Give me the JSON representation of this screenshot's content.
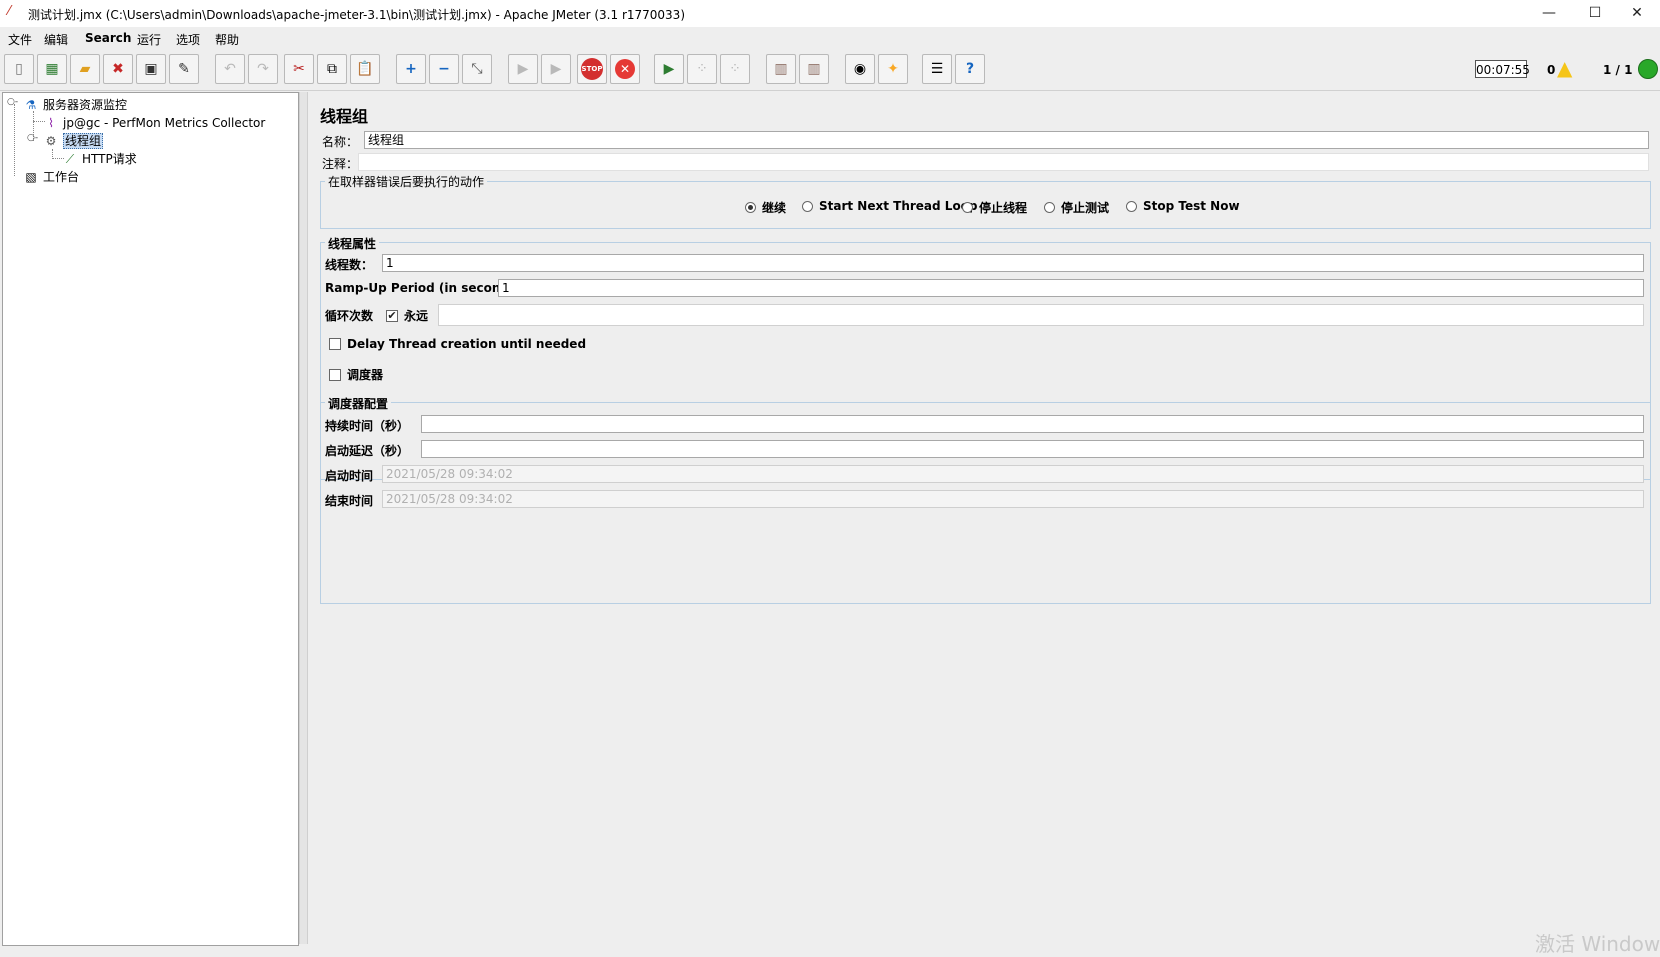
{
  "window": {
    "title": "测试计划.jmx (C:\\Users\\admin\\Downloads\\apache-jmeter-3.1\\bin\\测试计划.jmx) - Apache JMeter (3.1 r1770033)",
    "minimize": "—",
    "maximize": "☐",
    "close": "✕"
  },
  "menu": [
    "文件",
    "编辑",
    "Search",
    "运行",
    "选项",
    "帮助"
  ],
  "status": {
    "timer": "00:07:55",
    "error_count": "0",
    "threads": "1 / 1",
    "light_color": "#29a829"
  },
  "tree": {
    "root": "服务器资源监控",
    "perfmon": "jp@gc - PerfMon Metrics Collector",
    "thread_group": "线程组",
    "http_request": "HTTP请求",
    "workbench": "工作台"
  },
  "panel": {
    "title": "线程组",
    "name_label": "名称：",
    "name_value": "线程组",
    "comment_label": "注释：",
    "comment_value": "",
    "error_action": {
      "title": "在取样器错误后要执行的动作",
      "options": [
        "继续",
        "Start Next Thread Loop",
        "停止线程",
        "停止测试",
        "Stop Test Now"
      ],
      "selected": "继续"
    },
    "thread_props": {
      "title": "线程属性",
      "threads_label": "线程数：",
      "threads_value": "1",
      "rampup_label": "Ramp-Up Period (in seconds):",
      "rampup_value": "1",
      "loop_label": "循环次数",
      "forever_label": "永远",
      "forever_checked": "✔",
      "loop_value": "",
      "delay_label": "Delay Thread creation until needed",
      "scheduler_label": "调度器"
    },
    "scheduler": {
      "title": "调度器配置",
      "duration_label": "持续时间（秒）",
      "duration_value": "",
      "delay_label": "启动延迟（秒）",
      "delay_value": "",
      "start_label": "启动时间",
      "start_value": "2021/05/28 09:34:02",
      "end_label": "结束时间",
      "end_value": "2021/05/28 09:34:02"
    }
  },
  "watermark": "激活 Window"
}
